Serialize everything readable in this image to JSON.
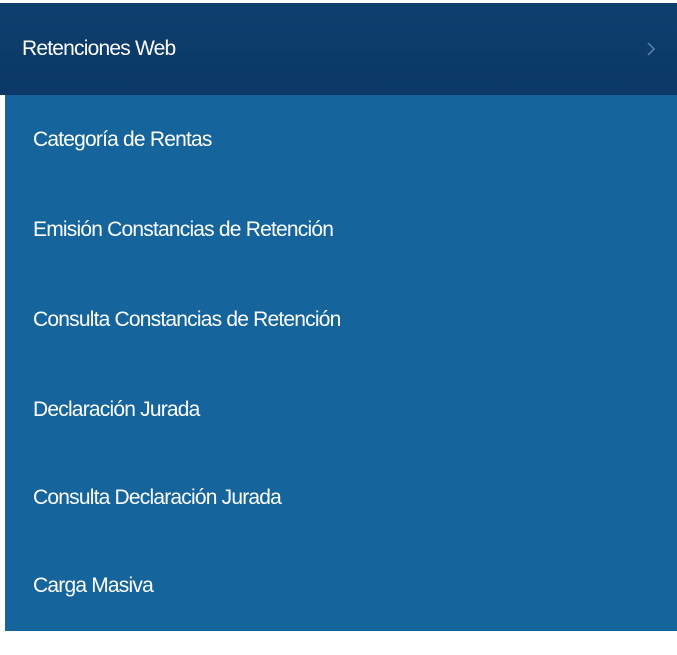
{
  "menu": {
    "header": {
      "label": "Retenciones Web",
      "icon": "chevron-right-icon"
    },
    "items": [
      {
        "label": "Categoría de Rentas"
      },
      {
        "label": "Emisión Constancias de Retención"
      },
      {
        "label": "Consulta Constancias de Retención"
      },
      {
        "label": "Declaración Jurada"
      },
      {
        "label": "Consulta Declaración Jurada"
      },
      {
        "label": "Carga Masiva"
      }
    ]
  },
  "colors": {
    "header_bg": "#0b3866",
    "submenu_bg": "#15649b",
    "text": "#ffffff",
    "chevron": "#5f84a8"
  }
}
